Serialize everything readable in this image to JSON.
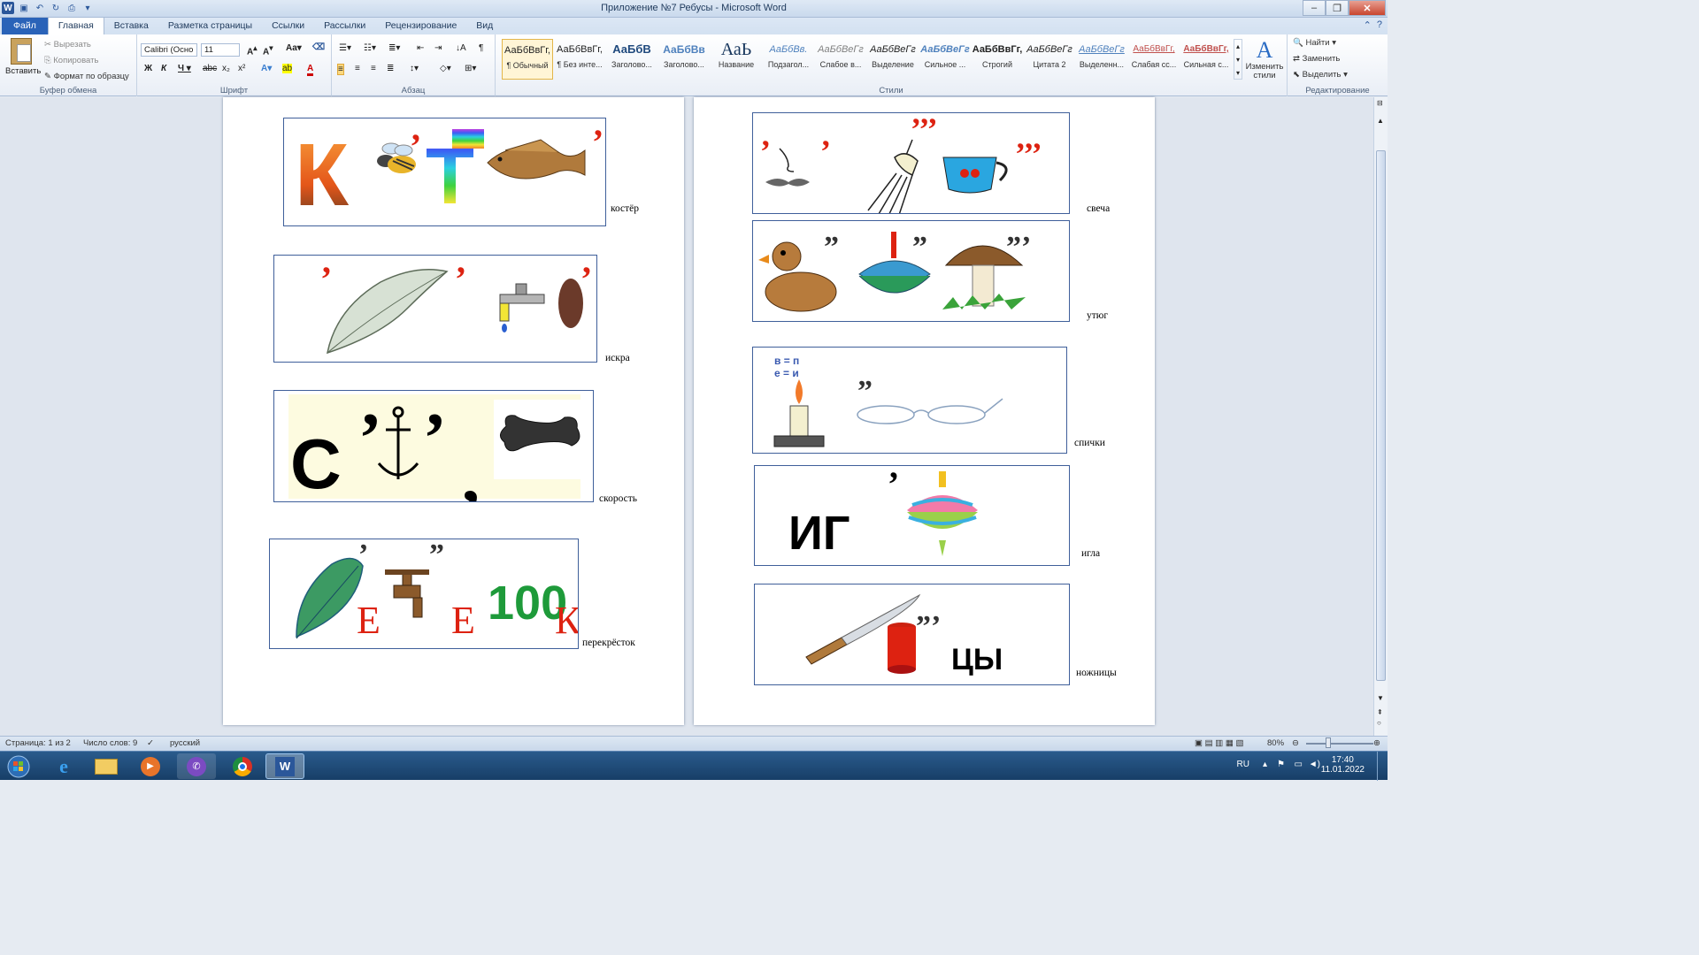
{
  "window": {
    "title": "Приложение №7 Ребусы - Microsoft Word"
  },
  "tabs": [
    "Файл",
    "Главная",
    "Вставка",
    "Разметка страницы",
    "Ссылки",
    "Рассылки",
    "Рецензирование",
    "Вид"
  ],
  "clipboard": {
    "paste": "Вставить",
    "cut": "Вырезать",
    "copy": "Копировать",
    "format_painter": "Формат по образцу",
    "label": "Буфер обмена"
  },
  "font": {
    "name": "Calibri (Осно",
    "size": "11",
    "label": "Шрифт"
  },
  "paragraph": {
    "label": "Абзац"
  },
  "styles": {
    "label": "Стили",
    "items": [
      {
        "sample": "АаБбВвГг,",
        "name": "¶ Обычный"
      },
      {
        "sample": "АаБбВвГг,",
        "name": "¶ Без инте..."
      },
      {
        "sample": "АаБбВ",
        "name": "Заголово..."
      },
      {
        "sample": "АаБбВв",
        "name": "Заголово..."
      },
      {
        "sample": "АаЬ",
        "name": "Название"
      },
      {
        "sample": "АаБбВв.",
        "name": "Подзагол..."
      },
      {
        "sample": "АаБбВеГг",
        "name": "Слабое в..."
      },
      {
        "sample": "АаБбВеГг",
        "name": "Выделение"
      },
      {
        "sample": "АаБбВеГг",
        "name": "Сильное ..."
      },
      {
        "sample": "АаБбВвГг,",
        "name": "Строгий"
      },
      {
        "sample": "АаБбВеГг",
        "name": "Цитата 2"
      },
      {
        "sample": "АаБбВеГг",
        "name": "Выделенн..."
      },
      {
        "sample": "АаБбВвГг,",
        "name": "Слабая сс..."
      },
      {
        "sample": "АаБбВвГг,",
        "name": "Сильная с..."
      }
    ],
    "change": "Изменить стили"
  },
  "editing": {
    "find": "Найти",
    "replace": "Заменить",
    "select": "Выделить",
    "label": "Редактирование"
  },
  "rebus": {
    "left": [
      {
        "answer": "костёр",
        "letters": "К  Т"
      },
      {
        "answer": "искра"
      },
      {
        "answer": "скорость",
        "letters": "С"
      },
      {
        "answer": "перекрёсток",
        "letters": [
          "Е",
          "Е",
          "100",
          "К"
        ]
      }
    ],
    "right": [
      {
        "answer": "свеча"
      },
      {
        "answer": "утюг"
      },
      {
        "answer": "спички",
        "letters": [
          "в = п",
          "е = и"
        ]
      },
      {
        "answer": "игла",
        "letters": "ИГ"
      },
      {
        "answer": "ножницы",
        "letters": "ЦЫ"
      }
    ]
  },
  "status": {
    "page": "Страница: 1 из 2",
    "words": "Число слов: 9",
    "lang": "русский",
    "zoom": "80%"
  },
  "tray": {
    "lang": "RU",
    "time": "17:40",
    "date": "11.01.2022"
  }
}
